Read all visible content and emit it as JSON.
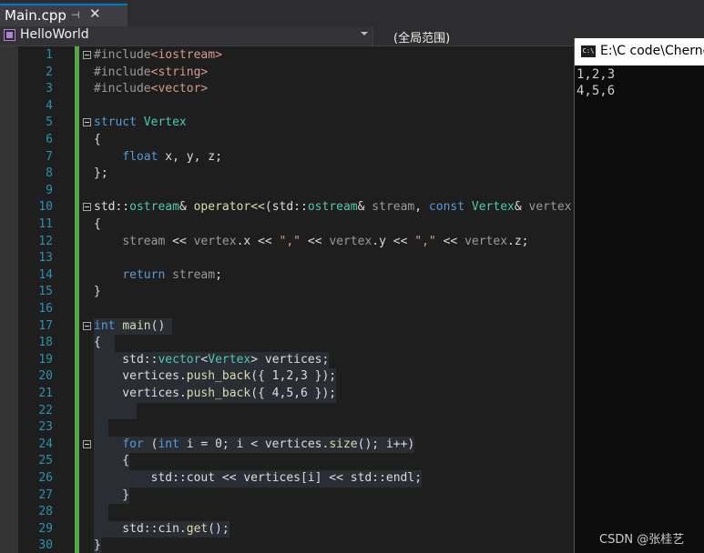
{
  "tab": {
    "title": "Main.cpp",
    "pin_icon": "pin-icon",
    "close_glyph": "✕"
  },
  "navigation": {
    "project": "HelloWorld",
    "scope": "(全局范围)"
  },
  "editor": {
    "lines": [
      {
        "n": "1",
        "fold": true,
        "hl": false,
        "tokens": [
          [
            "pp",
            "#include"
          ],
          [
            "inc",
            "<iostream>"
          ]
        ]
      },
      {
        "n": "2",
        "fold": false,
        "hl": false,
        "tokens": [
          [
            "pp",
            "#include"
          ],
          [
            "inc",
            "<string>"
          ]
        ]
      },
      {
        "n": "3",
        "fold": false,
        "hl": false,
        "tokens": [
          [
            "pp",
            "#include"
          ],
          [
            "inc",
            "<vector>"
          ]
        ]
      },
      {
        "n": "4",
        "fold": false,
        "hl": false,
        "tokens": []
      },
      {
        "n": "5",
        "fold": true,
        "hl": false,
        "tokens": [
          [
            "kw",
            "struct"
          ],
          [
            "pl",
            " "
          ],
          [
            "ty",
            "Vertex"
          ]
        ]
      },
      {
        "n": "6",
        "fold": false,
        "hl": false,
        "tokens": [
          [
            "pl",
            "{"
          ]
        ]
      },
      {
        "n": "7",
        "fold": false,
        "hl": false,
        "tokens": [
          [
            "pl",
            "    "
          ],
          [
            "kw",
            "float"
          ],
          [
            "pl",
            " x, y, z;"
          ]
        ]
      },
      {
        "n": "8",
        "fold": false,
        "hl": false,
        "tokens": [
          [
            "pl",
            "};"
          ]
        ]
      },
      {
        "n": "9",
        "fold": false,
        "hl": false,
        "tokens": []
      },
      {
        "n": "10",
        "fold": true,
        "hl": false,
        "tokens": [
          [
            "pl",
            "std::"
          ],
          [
            "ty",
            "ostream"
          ],
          [
            "pl",
            "& "
          ],
          [
            "fn",
            "operator<<"
          ],
          [
            "pl",
            "(std::"
          ],
          [
            "ty",
            "ostream"
          ],
          [
            "pl",
            "& "
          ],
          [
            "pa",
            "stream"
          ],
          [
            "pl",
            ", "
          ],
          [
            "kw",
            "const"
          ],
          [
            "pl",
            " "
          ],
          [
            "ty",
            "Vertex"
          ],
          [
            "pl",
            "& "
          ],
          [
            "pa",
            "vertex"
          ],
          [
            "pl",
            ")"
          ]
        ]
      },
      {
        "n": "11",
        "fold": false,
        "hl": false,
        "tokens": [
          [
            "pl",
            "{"
          ]
        ]
      },
      {
        "n": "12",
        "fold": false,
        "hl": false,
        "tokens": [
          [
            "pl",
            "    "
          ],
          [
            "pa",
            "stream"
          ],
          [
            "pl",
            " << "
          ],
          [
            "pa",
            "vertex"
          ],
          [
            "pl",
            ".x << "
          ],
          [
            "st",
            "\",\""
          ],
          [
            "pl",
            " << "
          ],
          [
            "pa",
            "vertex"
          ],
          [
            "pl",
            ".y << "
          ],
          [
            "st",
            "\",\""
          ],
          [
            "pl",
            " << "
          ],
          [
            "pa",
            "vertex"
          ],
          [
            "pl",
            ".z;"
          ]
        ]
      },
      {
        "n": "13",
        "fold": false,
        "hl": false,
        "tokens": []
      },
      {
        "n": "14",
        "fold": false,
        "hl": false,
        "tokens": [
          [
            "pl",
            "    "
          ],
          [
            "kw",
            "return"
          ],
          [
            "pl",
            " "
          ],
          [
            "pa",
            "stream"
          ],
          [
            "pl",
            ";"
          ]
        ]
      },
      {
        "n": "15",
        "fold": false,
        "hl": false,
        "tokens": [
          [
            "pl",
            "}"
          ]
        ]
      },
      {
        "n": "16",
        "fold": false,
        "hl": false,
        "tokens": []
      },
      {
        "n": "17",
        "fold": true,
        "hl": true,
        "tokens": [
          [
            "kw",
            "int"
          ],
          [
            "pl",
            " "
          ],
          [
            "fn",
            "main"
          ],
          [
            "pl",
            "() "
          ]
        ]
      },
      {
        "n": "18",
        "fold": false,
        "hl": true,
        "tokens": [
          [
            "pl",
            "{  "
          ]
        ]
      },
      {
        "n": "19",
        "fold": false,
        "hl": true,
        "tokens": [
          [
            "pl",
            "    std::"
          ],
          [
            "ty",
            "vector"
          ],
          [
            "pl",
            "<"
          ],
          [
            "ty",
            "Vertex"
          ],
          [
            "pl",
            "> vertices;"
          ]
        ]
      },
      {
        "n": "20",
        "fold": false,
        "hl": true,
        "tokens": [
          [
            "pl",
            "    vertices."
          ],
          [
            "fn",
            "push_back"
          ],
          [
            "pl",
            "({ 1,2,3 });"
          ]
        ]
      },
      {
        "n": "21",
        "fold": false,
        "hl": true,
        "tokens": [
          [
            "pl",
            "    vertices."
          ],
          [
            "fn",
            "push_back"
          ],
          [
            "pl",
            "({ 4,5,6 });"
          ]
        ]
      },
      {
        "n": "22",
        "fold": false,
        "hl": true,
        "tokens": [
          [
            "pl",
            "      "
          ]
        ]
      },
      {
        "n": "23",
        "fold": false,
        "hl": true,
        "tokens": [
          [
            "pl",
            "  "
          ]
        ]
      },
      {
        "n": "24",
        "fold": true,
        "hl": true,
        "tokens": [
          [
            "pl",
            "    "
          ],
          [
            "kw",
            "for"
          ],
          [
            "pl",
            " ("
          ],
          [
            "kw",
            "int"
          ],
          [
            "pl",
            " i = 0; i < vertices."
          ],
          [
            "fn",
            "size"
          ],
          [
            "pl",
            "(); i++)"
          ]
        ]
      },
      {
        "n": "25",
        "fold": false,
        "hl": true,
        "tokens": [
          [
            "pl",
            "    {"
          ]
        ]
      },
      {
        "n": "26",
        "fold": false,
        "hl": true,
        "tokens": [
          [
            "pl",
            "        std::cout << vertices[i] << std::endl;"
          ]
        ]
      },
      {
        "n": "27",
        "fold": false,
        "hl": true,
        "tokens": [
          [
            "pl",
            "    }"
          ]
        ]
      },
      {
        "n": "28",
        "fold": false,
        "hl": true,
        "tokens": [
          [
            "pl",
            "  "
          ]
        ]
      },
      {
        "n": "29",
        "fold": false,
        "hl": true,
        "tokens": [
          [
            "pl",
            "    std::cin."
          ],
          [
            "fn",
            "get"
          ],
          [
            "pl",
            "();"
          ]
        ]
      },
      {
        "n": "30",
        "fold": false,
        "hl": true,
        "tokens": [
          [
            "pl",
            "}"
          ]
        ]
      }
    ]
  },
  "console": {
    "title": "E:\\C code\\Cherno",
    "icon_text": "C:\\",
    "output": [
      "1,2,3",
      "4,5,6"
    ]
  },
  "watermark": "CSDN @张桂艺"
}
